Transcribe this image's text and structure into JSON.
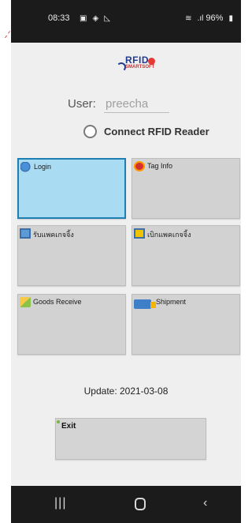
{
  "status_bar": {
    "time": "08:33",
    "left_icons": [
      "gallery-icon",
      "shield-icon",
      "chart-icon"
    ],
    "battery": "96%"
  },
  "logo": {
    "brand": "RFID",
    "sub": "SMARTSOFT"
  },
  "user": {
    "label": "User:",
    "value": "preecha"
  },
  "reader": {
    "label": "Connect RFID Reader",
    "checked": false
  },
  "tiles": [
    {
      "label": "Login",
      "icon": "login-icon",
      "active": true
    },
    {
      "label": "Tag Info",
      "icon": "tag-icon",
      "active": false
    },
    {
      "label": "รับแพคเกจจิ้ง",
      "icon": "receive-package-icon",
      "active": false
    },
    {
      "label": "เบิกแพคเกจจิ้ง",
      "icon": "withdraw-package-icon",
      "active": false
    },
    {
      "label": "Goods Receive",
      "icon": "goods-receive-icon",
      "active": false
    },
    {
      "label": "Shipment",
      "icon": "truck-icon",
      "active": false
    }
  ],
  "update": "Update: 2021-03-08",
  "exit_label": "Exit",
  "nav": {
    "recent": "|||",
    "back": "‹"
  },
  "colors": {
    "active_tile": "#a9dcf3",
    "active_border": "#1e7fb3",
    "tile": "#d2d2d2"
  }
}
